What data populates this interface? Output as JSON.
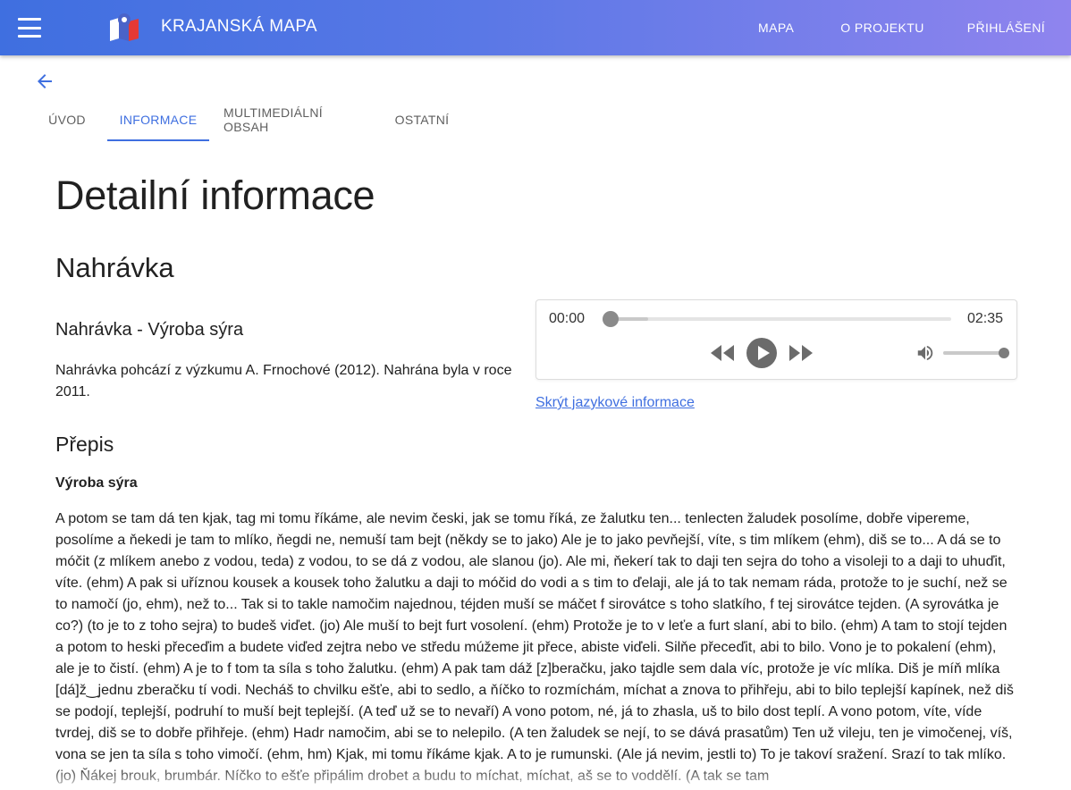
{
  "header": {
    "brand": "KRAJANSKÁ MAPA",
    "nav": [
      "MAPA",
      "O PROJEKTU",
      "PŘIHLÁŠENÍ"
    ]
  },
  "tabs": [
    {
      "label": "ÚVOD",
      "active": false
    },
    {
      "label": "INFORMACE",
      "active": true
    },
    {
      "label": "MULTIMEDIÁLNÍ OBSAH",
      "active": false
    },
    {
      "label": "OSTATNÍ",
      "active": false
    }
  ],
  "page_title": "Detailní informace",
  "recording": {
    "section_title": "Nahrávka",
    "title": "Nahrávka - Výroba sýra",
    "description": "Nahrávka pohcází z výzkumu A. Frnochové (2012). Nahrána byla v roce 2011.",
    "player": {
      "current_time": "00:00",
      "duration": "02:35",
      "progress": 0,
      "buffered": 0.13,
      "volume": 1.0
    },
    "language_link": "Skrýt jazykové informace"
  },
  "transcript": {
    "title": "Přepis",
    "subtitle": "Výroba sýra",
    "text": "A potom se tam dá ten kjak, tag mi tomu říkáme, ale nevim česki, jak se tomu říká, ze žalutku ten... tenlecten žaludek posolíme, dobře vipereme, posolíme a ňekedi je tam to mlíko, ňegdi ne, nemuší tam bejt (někdy se to jako) Ale je to jako pevňejší, víte, s tim mlíkem (ehm), diš se to... A dá se to móčit (z mlíkem anebo z vodou, teda) z vodou, to se dá z vodou, ale slanou (jo). Ale mi, ňekerí tak to daji ten sejra do toho a visoleji to a daji to uhuďit, víte. (ehm) A pak si uříznou kousek a kousek toho žalutku a daji to móčid do vodi a s tim to ďelaji, ale já to tak nemam ráda, protože to je suchí, než se to namočí (jo, ehm), než to... Tak si to takle namočim najednou, téjden muší se máčet f sirovátce s toho slatkího, f tej sirovátce tejden. (A syrovátka je co?) (to je to z toho sejra) to budeš viďet. (jo) Ale muší to bejt furt vosolení. (ehm) Protože je to v leťe a furt slaní, abi to bilo. (ehm) A tam to stojí tejden a potom to heski přeceďim a budete viďed zejtra nebo ve středu múžeme jit přece, abiste viďeli. Silňe přeceďit, abi to bilo. Vono je to pokalení (ehm), ale je to čistí. (ehm) A je to f tom ta síla s toho žalutku. (ehm) A pak tam dáž [z]beračku, jako tajdle sem dala víc, protože je víc mlíka. Diš je míň mlíka [dá]ž‿jednu zberačku tí vodi. Necháš to chvilku ešťe, abi to sedlo, a ňíčko to rozmíchám, míchat a znova to přihřeju, abi to bilo teplejší kapínek, než diš se podojí, teplejší, podruhí to muší bejt teplejší. (A teď už se to nevaří) A vono potom, né, já to zhasla, uš to bilo dost teplí. A vono potom, víte, víde tvrdej, diš se to dobře přihřeje. (ehm) Hadr namočim, abi se to nelepilo. (A ten žaludek se nejí, to se dává prasatům) Ten už vileju, ten je vimočenej, víš, vona se jen ta síla s toho vimočí. (ehm, hm) Kjak, mi tomu říkáme kjak. A to je rumunski. (Ale já nevim, jestli to) To je takoví sražení. Srazí to tak mlíko. (jo) Ňákej brouk, brumbár. Níčko to ešťe připálim drobet a budu to míchat, míchat, aš se to voddělí. (A tak se tam"
  },
  "icons": [
    "menu-icon",
    "logo-icon",
    "arrow-left-icon",
    "rewind-icon",
    "play-icon",
    "fast-forward-icon",
    "volume-icon"
  ],
  "colors": {
    "accent": "#3f6fe0",
    "header_gradient_start": "#3f6fe0",
    "header_gradient_end": "#8f84ee"
  }
}
